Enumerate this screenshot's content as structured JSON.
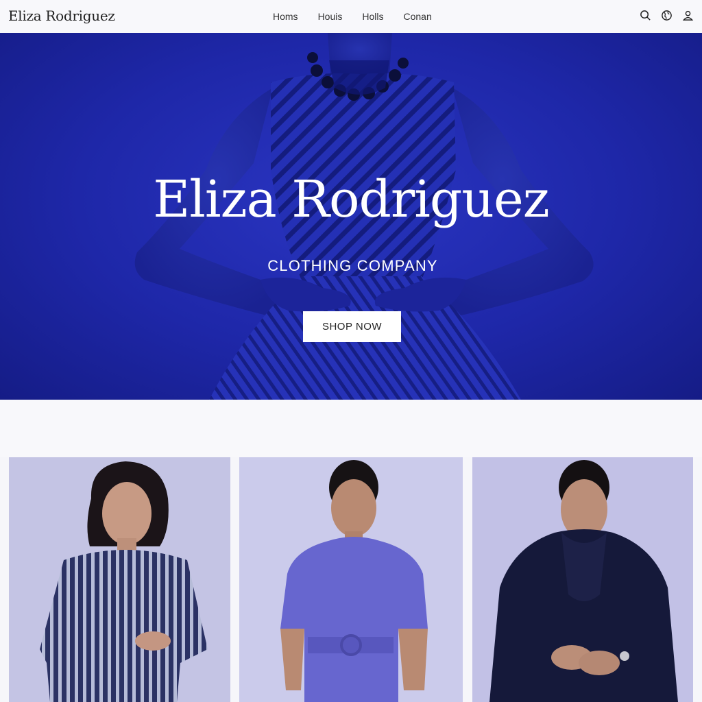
{
  "header": {
    "brand": "Eliza Rodriguez",
    "nav": [
      "Homs",
      "Houis",
      "Holls",
      "Conan"
    ],
    "icons": [
      "search-icon",
      "globe-icon",
      "user-icon"
    ]
  },
  "hero": {
    "title": "Eliza Rodriguez",
    "subtitle": "CLOTHING COMPANY",
    "cta": "SHOP NOW"
  },
  "colors": {
    "hero_blue": "#1e27a8",
    "card_bg": "#c9c9ea",
    "button_bg": "#ffffff"
  },
  "products": [
    {
      "image": "woman-in-striped-dress"
    },
    {
      "image": "woman-in-periwinkle-belted-dress"
    },
    {
      "image": "woman-in-navy-coat"
    }
  ]
}
